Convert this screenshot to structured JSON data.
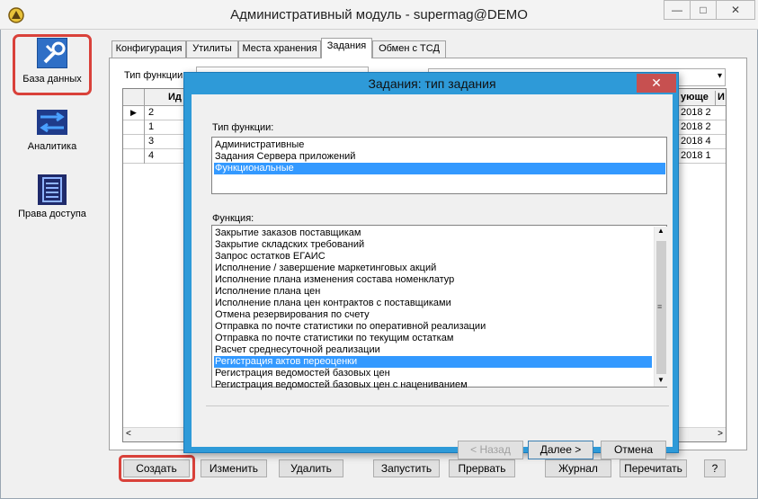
{
  "window": {
    "title": "Административный модуль - supermag@DEMO",
    "min_glyph": "—",
    "max_glyph": "□",
    "close_glyph": "✕"
  },
  "nav": [
    {
      "label": "База данных",
      "icon": "database-tools-icon"
    },
    {
      "label": "Аналитика",
      "icon": "arrows-icon"
    },
    {
      "label": "Права доступа",
      "icon": "access-rights-icon"
    }
  ],
  "tabs": [
    "Конфигурация",
    "Утилиты",
    "Места хранения",
    "Задания",
    "Обмен с ТСД"
  ],
  "active_tab": "Задания",
  "filter": {
    "func_type_label": "Тип функции:"
  },
  "grid": {
    "header_id": "Ид",
    "header_right1": "ующе",
    "header_right2": "И",
    "rows": [
      {
        "id": "2",
        "date": "2018 2"
      },
      {
        "id": "1",
        "date": "2018 2"
      },
      {
        "id": "3",
        "date": "2018 4"
      },
      {
        "id": "4",
        "date": "2018 1"
      }
    ]
  },
  "buttons": {
    "create": "Создать",
    "edit": "Изменить",
    "delete": "Удалить",
    "start": "Запустить",
    "interrupt": "Прервать",
    "log": "Журнал",
    "reread": "Перечитать",
    "help": "?"
  },
  "dialog": {
    "title": "Задания: тип задания",
    "close": "✕",
    "type_label": "Тип функции:",
    "types": [
      "Административные",
      "Задания Сервера приложений",
      "Функциональные"
    ],
    "selected_type": "Функциональные",
    "function_label": "Функция:",
    "functions": [
      "Закрытие заказов поставщикам",
      "Закрытие складских требований",
      "Запрос остатков ЕГАИС",
      "Исполнение / завершение маркетинговых акций",
      "Исполнение плана изменения состава номенклатур",
      "Исполнение плана цен",
      "Исполнение плана цен контрактов с поставщиками",
      "Отмена резервирования по счету",
      "Отправка по почте статистики по оперативной реализации",
      "Отправка по почте статистики по текущим остаткам",
      "Расчет среднесуточной реализации",
      "Регистрация актов переоценки",
      "Регистрация ведомостей базовых цен",
      "Регистрация ведомостей базовых цен с нацениванием"
    ],
    "selected_function": "Регистрация актов переоценки",
    "back": "< Назад",
    "next": "Далее >",
    "cancel": "Отмена"
  }
}
